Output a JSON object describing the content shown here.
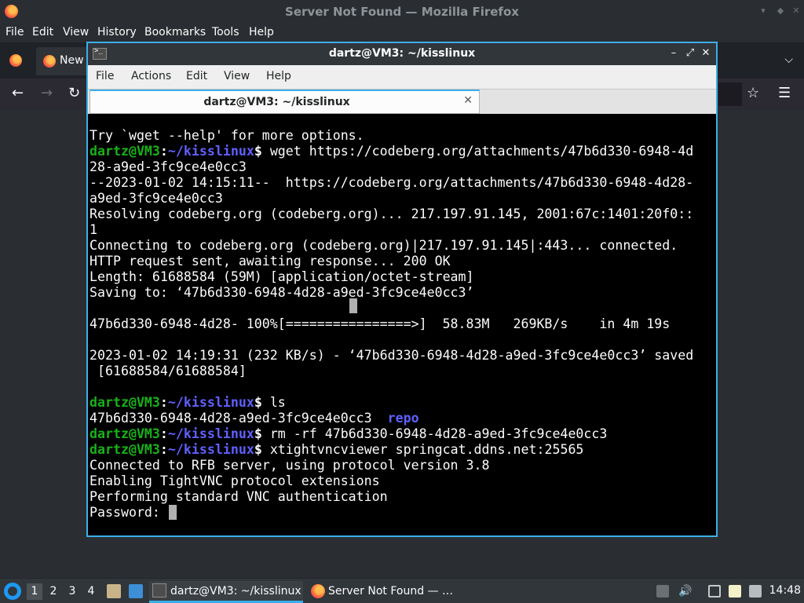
{
  "firefox": {
    "window_title": "Server Not Found — Mozilla Firefox",
    "menu": [
      "File",
      "Edit",
      "View",
      "History",
      "Bookmarks",
      "Tools",
      "Help"
    ],
    "tab_label": "New"
  },
  "terminal": {
    "window_title": "dartz@VM3: ~/kisslinux",
    "menu": [
      "File",
      "Actions",
      "Edit",
      "View",
      "Help"
    ],
    "tab_label": "dartz@VM3: ~/kisslinux",
    "prompt": {
      "user_host": "dartz@VM3",
      "path": "~/kisslinux"
    },
    "lines": [
      {
        "kind": "out",
        "text": "Try `wget --help' for more options."
      },
      {
        "kind": "cmd",
        "text": "wget https://codeberg.org/attachments/47b6d330-6948-4d"
      },
      {
        "kind": "out",
        "text": "28-a9ed-3fc9ce4e0cc3"
      },
      {
        "kind": "out",
        "text": "--2023-01-02 14:15:11--  https://codeberg.org/attachments/47b6d330-6948-4d28-"
      },
      {
        "kind": "out",
        "text": "a9ed-3fc9ce4e0cc3"
      },
      {
        "kind": "out",
        "text": "Resolving codeberg.org (codeberg.org)... 217.197.91.145, 2001:67c:1401:20f0::"
      },
      {
        "kind": "out",
        "text": "1"
      },
      {
        "kind": "out",
        "text": "Connecting to codeberg.org (codeberg.org)|217.197.91.145|:443... connected."
      },
      {
        "kind": "out",
        "text": "HTTP request sent, awaiting response... 200 OK"
      },
      {
        "kind": "out",
        "text": "Length: 61688584 (59M) [application/octet-stream]"
      },
      {
        "kind": "out",
        "text": "Saving to: ‘47b6d330-6948-4d28-a9ed-3fc9ce4e0cc3’"
      },
      {
        "kind": "out",
        "text": ""
      },
      {
        "kind": "out",
        "text": "47b6d330-6948-4d28- 100%[================>]  58.83M   269KB/s    in 4m 19s"
      },
      {
        "kind": "out",
        "text": ""
      },
      {
        "kind": "out",
        "text": "2023-01-02 14:19:31 (232 KB/s) - ‘47b6d330-6948-4d28-a9ed-3fc9ce4e0cc3’ saved"
      },
      {
        "kind": "out",
        "text": " [61688584/61688584]"
      },
      {
        "kind": "out",
        "text": ""
      },
      {
        "kind": "cmd",
        "text": "ls"
      },
      {
        "kind": "ls",
        "text": "47b6d330-6948-4d28-a9ed-3fc9ce4e0cc3",
        "dir": "repo"
      },
      {
        "kind": "cmd",
        "text": "rm -rf 47b6d330-6948-4d28-a9ed-3fc9ce4e0cc3"
      },
      {
        "kind": "cmd",
        "text": "xtightvncviewer springcat.ddns.net:25565"
      },
      {
        "kind": "out",
        "text": "Connected to RFB server, using protocol version 3.8"
      },
      {
        "kind": "out",
        "text": "Enabling TightVNC protocol extensions"
      },
      {
        "kind": "out",
        "text": "Performing standard VNC authentication"
      },
      {
        "kind": "out",
        "text": "Password: "
      }
    ]
  },
  "taskbar": {
    "desktops": [
      "1",
      "2",
      "3",
      "4"
    ],
    "tasks": [
      {
        "label": "dartz@VM3: ~/kisslinux",
        "icon": "terminal-icon"
      },
      {
        "label": "Server Not Found — …",
        "icon": "firefox-icon"
      }
    ],
    "clock": "14:48"
  },
  "colors": {
    "accent": "#3daee9",
    "prompt_user": "#18b218",
    "prompt_path": "#6060ff"
  }
}
